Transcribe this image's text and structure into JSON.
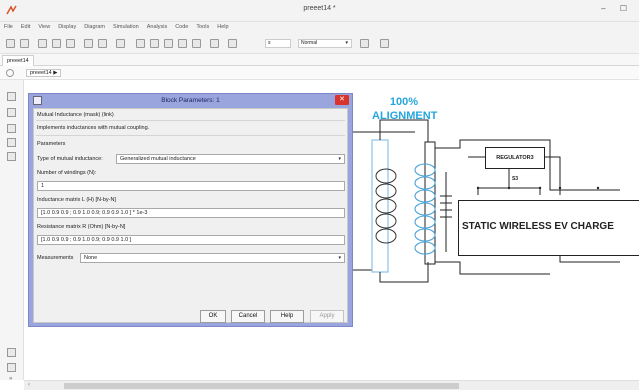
{
  "window": {
    "title": "preeet14 *",
    "controls_label": "– ☐"
  },
  "menu": [
    "File",
    "Edit",
    "View",
    "Display",
    "Diagram",
    "Simulation",
    "Analysis",
    "Code",
    "Tools",
    "Help"
  ],
  "toolbar": {
    "sim_time": "s",
    "mode": "Normal"
  },
  "model_tab": "preeet14",
  "breadcrumb": "preeet14 ▶",
  "dialog": {
    "title": "Block Parameters: 1",
    "block_type": "Mutual Inductance (mask) (link)",
    "description": "Implements inductances with mutual coupling.",
    "parameters_heading": "Parameters",
    "type_label": "Type of mutual inductance:",
    "type_value": "Generalized mutual inductance",
    "windings_label": "Number of windings (N):",
    "windings_value": "1",
    "inductance_label": "Inductance matrix L (H) [N-by-N]",
    "inductance_value": "[1.0 0.9  0.9 ;  0.9 1.0  0.9;  0.9 0.9 1.0 ] * 1e-3",
    "resistance_label": "Resistance matrix R (Ohm) [N-by-N]",
    "resistance_value": "[1.0 0.9  0.9 ;  0.9 1.0  0.9;  0.9 0.9 1.0 ]",
    "measurements_label": "Measurements",
    "measurements_value": "None",
    "buttons": {
      "ok": "OK",
      "cancel": "Cancel",
      "help": "Help",
      "apply": "Apply"
    }
  },
  "diagram": {
    "alignment_line1": "100%",
    "alignment_line2": "ALIGNMENT",
    "regulator_label": "REGULATOR3",
    "regulator_sub": "S3",
    "charger_label": "STATIC WIRELESS EV CHARGE"
  },
  "colors": {
    "dialog_frame": "#9aa4dd",
    "close_button": "#d9342b",
    "alignment_text": "#26a6de",
    "coil_blue": "#4aa3d8",
    "coil_dark": "#333333"
  }
}
